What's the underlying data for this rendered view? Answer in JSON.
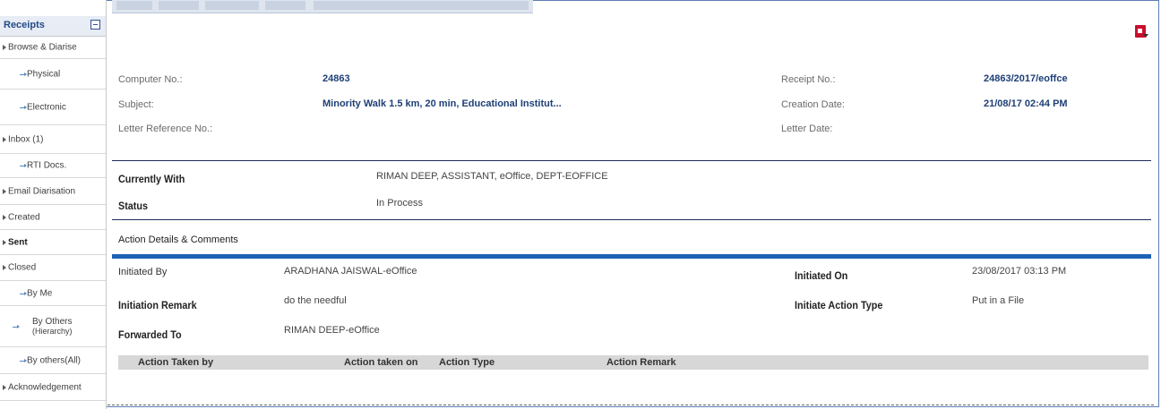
{
  "sidebar": {
    "title": "Receipts",
    "items": [
      {
        "label": "Browse & Diarise",
        "type": "top"
      },
      {
        "label": "Physical",
        "type": "sub"
      },
      {
        "label": "Electronic",
        "type": "sub"
      },
      {
        "label": "Inbox (1)",
        "type": "top"
      },
      {
        "label": "RTI Docs.",
        "type": "sub"
      },
      {
        "label": "Email Diarisation",
        "type": "top"
      },
      {
        "label": "Created",
        "type": "top"
      },
      {
        "label": "Sent",
        "type": "top",
        "bold": true
      },
      {
        "label": "Closed",
        "type": "top"
      },
      {
        "label": "By Me",
        "type": "sub"
      },
      {
        "label": "By Others",
        "sublabel": "(Hierarchy)",
        "type": "sub"
      },
      {
        "label": "By others(All)",
        "type": "sub"
      },
      {
        "label": "Acknowledgement",
        "type": "top"
      }
    ]
  },
  "receipt": {
    "computer_no_label": "Computer No.:",
    "computer_no": "24863",
    "subject_label": "Subject:",
    "subject": "Minority Walk 1.5 km, 20 min, Educational Institut...",
    "letter_ref_label": "Letter Reference No.:",
    "letter_ref": "",
    "receipt_no_label": "Receipt No.:",
    "receipt_no": "24863/2017/eoffce",
    "creation_date_label": "Creation Date:",
    "creation_date": "21/08/17 02:44 PM",
    "letter_date_label": "Letter Date:",
    "letter_date": ""
  },
  "status_block": {
    "currently_with_label": "Currently With",
    "currently_with": "RIMAN DEEP, ASSISTANT, eOffice, DEPT-EOFFICE",
    "status_label": "Status",
    "status": "In Process"
  },
  "action": {
    "section_title": "Action Details & Comments",
    "initiated_by_label": "Initiated By",
    "initiated_by": "ARADHANA JAISWAL-eOffice",
    "initiated_on_label": "Initiated On",
    "initiated_on": "23/08/2017 03:13 PM",
    "initiation_remark_label": "Initiation Remark",
    "initiation_remark": "do the needful",
    "initiate_action_type_label": "Initiate Action Type",
    "initiate_action_type": "Put in a File",
    "forwarded_to_label": "Forwarded To",
    "forwarded_to": "RIMAN DEEP-eOffice",
    "columns": [
      "Action Taken by",
      "Action taken on",
      "Action Type",
      "Action Remark"
    ]
  },
  "colors": {
    "accent": "#1f63b5",
    "label_blue": "#1d3f76",
    "sidebar_head": "#e7ecf5"
  },
  "icons": {
    "export": "pdf-icon"
  }
}
